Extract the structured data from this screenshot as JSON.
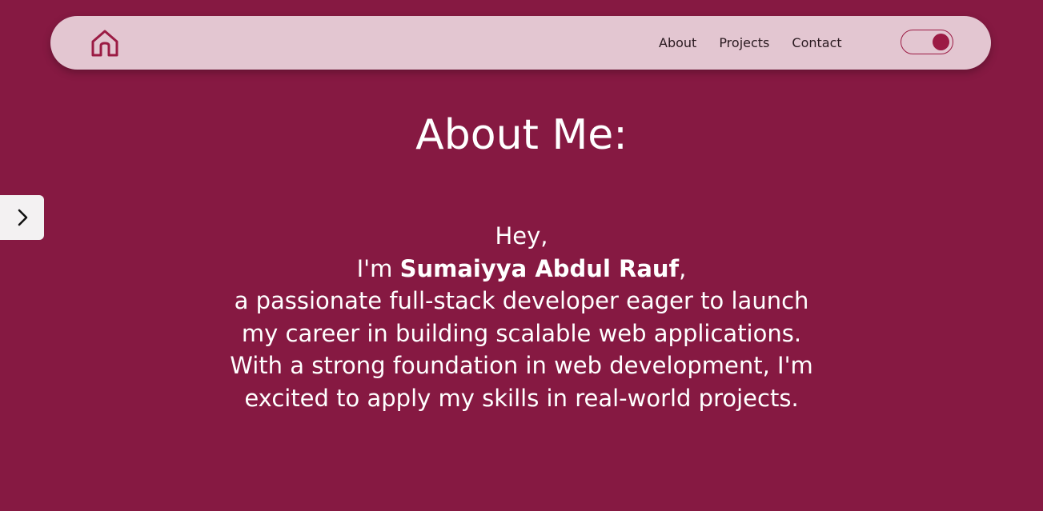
{
  "colors": {
    "page_background": "#861942",
    "navbar_background": "#e3c6d1",
    "accent": "#9b1b44",
    "text_light": "#ffffff",
    "nav_text": "#2a1a20",
    "arrow_button_background": "#f3f1f2"
  },
  "navbar": {
    "home_icon": "home-icon",
    "links": [
      {
        "label": "About"
      },
      {
        "label": "Projects"
      },
      {
        "label": "Contact"
      }
    ],
    "theme_toggle": {
      "state": "on"
    }
  },
  "side_button": {
    "icon": "chevron-right-icon"
  },
  "about": {
    "title": "About Me:",
    "greeting": "Hey,",
    "intro_prefix": "I'm ",
    "name": "Sumaiyya Abdul Rauf",
    "intro_suffix": ",",
    "lines": [
      "a passionate full-stack developer eager to launch",
      "my career in building scalable web applications.",
      "With a strong foundation in web development, I'm",
      "excited to apply my skills in real-world projects."
    ]
  }
}
